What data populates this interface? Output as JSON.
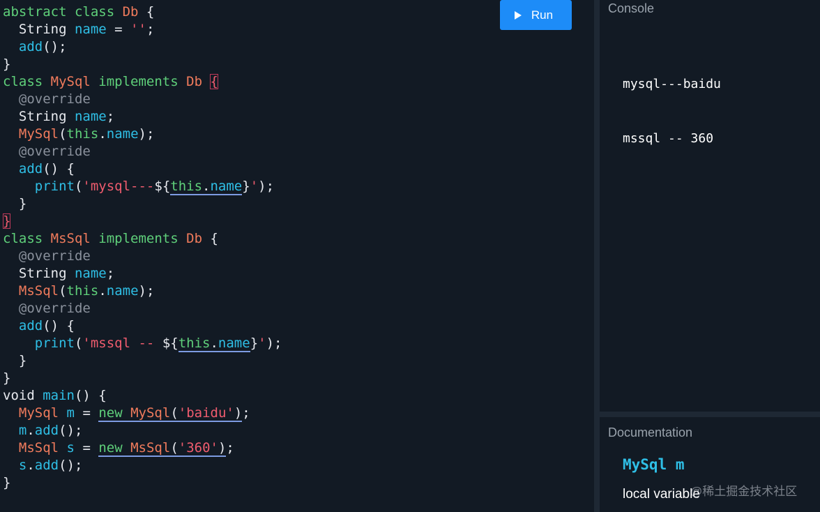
{
  "toolbar": {
    "run_label": "Run"
  },
  "console": {
    "title": "Console",
    "lines": [
      "mysql---baidu",
      "mssql -- 360"
    ]
  },
  "documentation": {
    "title": "Documentation",
    "signature": "MySql m",
    "description": "local variable"
  },
  "watermark": "@稀土掘金技术社区",
  "code": [
    [
      [
        "kw",
        "abstract class "
      ],
      [
        "cls",
        "Db"
      ],
      [
        "pl",
        " {"
      ]
    ],
    [
      [
        "pl",
        "  String "
      ],
      [
        "id",
        "name"
      ],
      [
        "pl",
        " = "
      ],
      [
        "str",
        "''"
      ],
      [
        "pl",
        ";"
      ]
    ],
    [
      [
        "pl",
        "  "
      ],
      [
        "id",
        "add"
      ],
      [
        "pl",
        "();"
      ]
    ],
    [
      [
        "pl",
        "}"
      ]
    ],
    [
      [
        "kw",
        "class "
      ],
      [
        "cls",
        "MySql"
      ],
      [
        "kw",
        " implements "
      ],
      [
        "cls",
        "Db"
      ],
      [
        "pl",
        " "
      ],
      [
        "brk-hl",
        "{"
      ]
    ],
    [
      [
        "ann",
        "  @override"
      ]
    ],
    [
      [
        "pl",
        "  String "
      ],
      [
        "id",
        "name"
      ],
      [
        "pl",
        ";"
      ]
    ],
    [
      [
        "pl",
        "  "
      ],
      [
        "cls",
        "MySql"
      ],
      [
        "pl",
        "("
      ],
      [
        "kw",
        "this"
      ],
      [
        "pl",
        "."
      ],
      [
        "id",
        "name"
      ],
      [
        "pl",
        ");"
      ]
    ],
    [
      [
        "ann",
        "  @override"
      ]
    ],
    [
      [
        "pl",
        "  "
      ],
      [
        "id",
        "add"
      ],
      [
        "pl",
        "() {"
      ]
    ],
    [
      [
        "pl",
        "    "
      ],
      [
        "id",
        "print"
      ],
      [
        "pl",
        "("
      ],
      [
        "str",
        "'mysql---"
      ],
      [
        "pl",
        "${"
      ],
      [
        "kw u",
        "this"
      ],
      [
        "pl u",
        "."
      ],
      [
        "id u",
        "name"
      ],
      [
        "pl",
        "}"
      ],
      [
        "str",
        "'"
      ],
      [
        "pl",
        ");"
      ]
    ],
    [
      [
        "pl",
        "  }"
      ]
    ],
    [
      [
        "brk-hl",
        "}"
      ]
    ],
    [
      [
        "kw",
        "class "
      ],
      [
        "cls",
        "MsSql"
      ],
      [
        "kw",
        " implements "
      ],
      [
        "cls",
        "Db"
      ],
      [
        "pl",
        " {"
      ]
    ],
    [
      [
        "ann",
        "  @override"
      ]
    ],
    [
      [
        "pl",
        "  String "
      ],
      [
        "id",
        "name"
      ],
      [
        "pl",
        ";"
      ]
    ],
    [
      [
        "pl",
        "  "
      ],
      [
        "cls",
        "MsSql"
      ],
      [
        "pl",
        "("
      ],
      [
        "kw",
        "this"
      ],
      [
        "pl",
        "."
      ],
      [
        "id",
        "name"
      ],
      [
        "pl",
        ");"
      ]
    ],
    [
      [
        "ann",
        "  @override"
      ]
    ],
    [
      [
        "pl",
        "  "
      ],
      [
        "id",
        "add"
      ],
      [
        "pl",
        "() {"
      ]
    ],
    [
      [
        "pl",
        "    "
      ],
      [
        "id",
        "print"
      ],
      [
        "pl",
        "("
      ],
      [
        "str",
        "'mssql -- "
      ],
      [
        "pl",
        "${"
      ],
      [
        "kw u",
        "this"
      ],
      [
        "pl u",
        "."
      ],
      [
        "id u",
        "name"
      ],
      [
        "pl",
        "}"
      ],
      [
        "str",
        "'"
      ],
      [
        "pl",
        ");"
      ]
    ],
    [
      [
        "pl",
        "  }"
      ]
    ],
    [
      [
        "pl",
        "}"
      ]
    ],
    [
      [
        "pl",
        "void "
      ],
      [
        "id",
        "main"
      ],
      [
        "pl",
        "() {"
      ]
    ],
    [
      [
        "pl",
        "  "
      ],
      [
        "cls",
        "MySql"
      ],
      [
        "pl",
        " "
      ],
      [
        "id",
        "m"
      ],
      [
        "pl",
        " = "
      ],
      [
        "kw u",
        "new"
      ],
      [
        "pl u",
        " "
      ],
      [
        "cls u",
        "MySql"
      ],
      [
        "pl u",
        "("
      ],
      [
        "str u",
        "'baidu'"
      ],
      [
        "pl u",
        ")"
      ],
      [
        "pl",
        ";"
      ]
    ],
    [
      [
        "pl",
        "  "
      ],
      [
        "id",
        "m"
      ],
      [
        "pl",
        "."
      ],
      [
        "id",
        "add"
      ],
      [
        "pl",
        "();"
      ]
    ],
    [
      [
        "pl",
        "  "
      ],
      [
        "cls",
        "MsSql"
      ],
      [
        "pl",
        " "
      ],
      [
        "id",
        "s"
      ],
      [
        "pl",
        " = "
      ],
      [
        "kw u",
        "new"
      ],
      [
        "pl u",
        " "
      ],
      [
        "cls u",
        "MsSql"
      ],
      [
        "pl u",
        "("
      ],
      [
        "str u",
        "'360'"
      ],
      [
        "pl u",
        ")"
      ],
      [
        "pl",
        ";"
      ]
    ],
    [
      [
        "pl",
        "  "
      ],
      [
        "id",
        "s"
      ],
      [
        "pl",
        "."
      ],
      [
        "id",
        "add"
      ],
      [
        "pl",
        "();"
      ]
    ],
    [
      [
        "pl",
        "}"
      ]
    ]
  ]
}
